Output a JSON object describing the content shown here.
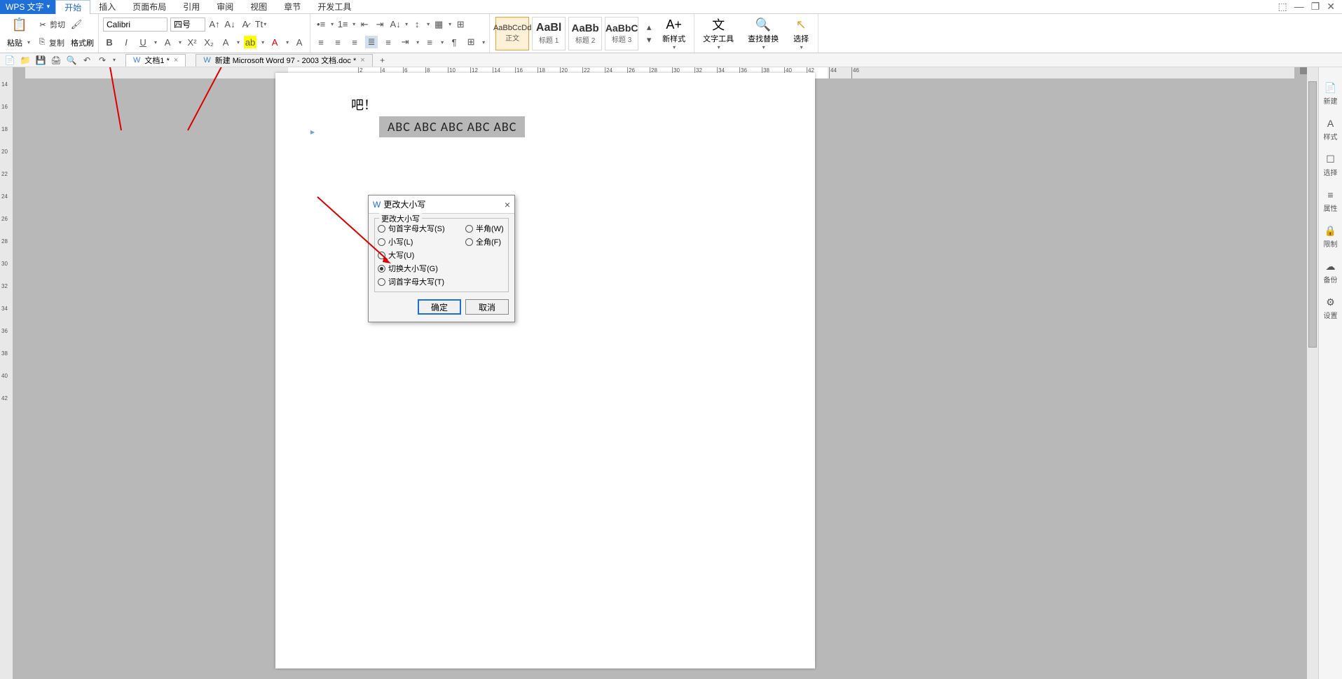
{
  "app": {
    "name": "WPS 文字"
  },
  "menu": {
    "tabs": [
      "开始",
      "插入",
      "页面布局",
      "引用",
      "审阅",
      "视图",
      "章节",
      "开发工具"
    ],
    "active": "开始"
  },
  "clipboard": {
    "paste": "粘贴",
    "cut": "剪切",
    "copy": "复制",
    "format_painter": "格式刷"
  },
  "font": {
    "family": "Calibri",
    "size": "四号",
    "bold": "B",
    "italic": "I",
    "underline": "U",
    "strike": "A"
  },
  "styles": {
    "items": [
      {
        "prev": "AaBbCcDd",
        "name": "正文"
      },
      {
        "prev": "AaBl",
        "name": "标题 1"
      },
      {
        "prev": "AaBb",
        "name": "标题 2"
      },
      {
        "prev": "AaBbC",
        "name": "标题 3"
      }
    ],
    "new_style": "新样式"
  },
  "tools": {
    "text_tools": "文字工具",
    "find_replace": "查找替换",
    "select": "选择"
  },
  "doc_tabs": [
    {
      "label": "文档1 *"
    },
    {
      "label": "新建 Microsoft Word 97 - 2003 文档.doc *"
    }
  ],
  "page": {
    "line1": "吧！",
    "selected": "ABC     ABC     ABC     ABC     ABC"
  },
  "sidebar": [
    {
      "icon": "📄",
      "label": "新建"
    },
    {
      "icon": "A",
      "label": "样式"
    },
    {
      "icon": "☐",
      "label": "选择"
    },
    {
      "icon": "≡",
      "label": "属性"
    },
    {
      "icon": "🔒",
      "label": "限制"
    },
    {
      "icon": "☁",
      "label": "备份"
    },
    {
      "icon": "⚙",
      "label": "设置"
    }
  ],
  "dialog": {
    "title": "更改大小写",
    "legend": "更改大小写",
    "options": {
      "sentence": "句首字母大写(S)",
      "lower": "小写(L)",
      "upper": "大写(U)",
      "toggle": "切换大小写(G)",
      "title": "词首字母大写(T)",
      "half": "半角(W)",
      "full": "全角(F)"
    },
    "ok": "确定",
    "cancel": "取消"
  },
  "ruler": {
    "marks": [
      2,
      4,
      6,
      8,
      10,
      12,
      14,
      16,
      18,
      20,
      22,
      24,
      26,
      28,
      30,
      32,
      34,
      36,
      38,
      40,
      42,
      44,
      46
    ]
  },
  "vruler": {
    "marks": [
      14,
      16,
      18,
      20,
      22,
      24,
      26,
      28,
      30,
      32,
      34,
      36,
      38,
      40,
      42
    ]
  }
}
